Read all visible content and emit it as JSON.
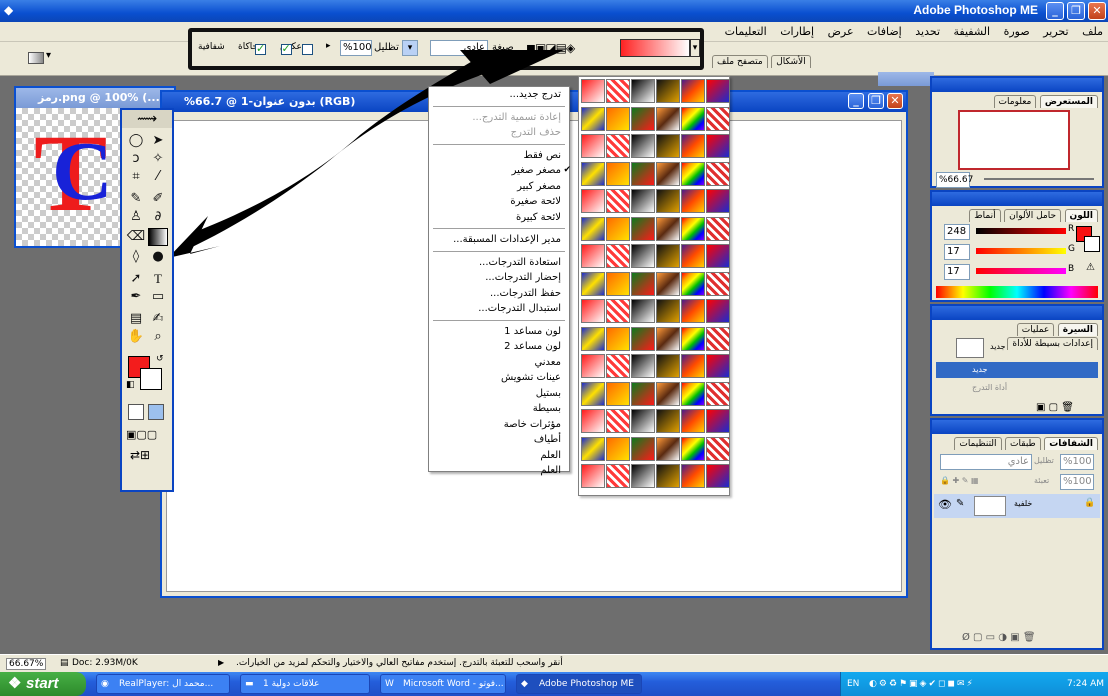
{
  "app": {
    "title": "Adobe Photoshop ME",
    "menu": [
      "ملف",
      "تحرير",
      "صورة",
      "الشفيفة",
      "تحديد",
      "إضافات",
      "عرض",
      "إطارات",
      "التعليمات"
    ]
  },
  "options": {
    "mode_label": "صيغة",
    "mode_value": "عادي",
    "opacity_label": "تظليل",
    "opacity_value": "%100",
    "reverse_label": "عكس",
    "dither_label": "محاكاة",
    "transparency_label": "شفافية",
    "tab_brushes": "الأشكال",
    "tab_file_browser": "متصفح ملف"
  },
  "documents": {
    "doc1_title": "رمز.png @ 100% (...",
    "doc2_title": "%بدون عنوان-1 @ 66.7 (RGB)"
  },
  "gradient_menu": {
    "items": [
      {
        "label": "تدرج جديد...",
        "state": "normal"
      },
      {
        "sep": true
      },
      {
        "label": "إعادة تسمية التدرج...",
        "state": "disabled"
      },
      {
        "label": "حذف التدرج",
        "state": "disabled"
      },
      {
        "sep": true
      },
      {
        "label": "نص فقط",
        "state": "normal"
      },
      {
        "label": "مصغر صغير",
        "state": "checked"
      },
      {
        "label": "مصغر كبير",
        "state": "normal"
      },
      {
        "label": "لائحة صغيرة",
        "state": "normal"
      },
      {
        "label": "لائحة كبيرة",
        "state": "normal"
      },
      {
        "sep": true
      },
      {
        "label": "مدير الإعدادات المسبقة...",
        "state": "normal"
      },
      {
        "sep": true
      },
      {
        "label": "استعادة التدرجات...",
        "state": "normal"
      },
      {
        "label": "إحضار التدرجات...",
        "state": "normal"
      },
      {
        "label": "حفظ التدرجات...",
        "state": "normal"
      },
      {
        "label": "استبدال التدرجات...",
        "state": "normal"
      },
      {
        "sep": true
      },
      {
        "label": "لون مساعد 1",
        "state": "normal"
      },
      {
        "label": "لون مساعد 2",
        "state": "normal"
      },
      {
        "label": "معدني",
        "state": "normal"
      },
      {
        "label": "عينات تشويش",
        "state": "normal"
      },
      {
        "label": "بستيل",
        "state": "normal"
      },
      {
        "label": "بسيطة",
        "state": "normal"
      },
      {
        "label": "مؤثرات خاصة",
        "state": "normal"
      },
      {
        "label": "أطياف",
        "state": "normal"
      },
      {
        "label": "العلم",
        "state": "normal"
      },
      {
        "label": "العلم",
        "state": "normal"
      }
    ]
  },
  "navigator": {
    "tab_info": "معلومات",
    "tab_navigator": "المستعرض",
    "zoom": "%66.67"
  },
  "color_palette": {
    "tab_styles": "أنماط",
    "tab_swatches": "حامل الألوان",
    "tab_color": "اللون",
    "r_label": "R",
    "g_label": "G",
    "b_label": "B",
    "r_value": "248",
    "g_value": "17",
    "b_value": "17",
    "accent": "#f81111"
  },
  "history": {
    "tab_actions": "إعدادات بسيطة للأداة",
    "tab_history": "عمليات",
    "tab_main": "السيرة",
    "snapshot_label": "جديد",
    "item1": "جديد",
    "item2": "أداة التدرج"
  },
  "layers": {
    "tab_channels": "التنظيمات",
    "tab_paths": "طبقات",
    "tab_layers": "الشفافات",
    "blend": "عادي",
    "opacity_label": "تظليل",
    "opacity_value": "%100",
    "fill_label": "تعبئة",
    "fill_value": "%100",
    "layer_name": "خلفية"
  },
  "status": {
    "zoom": "66.67%",
    "doc": "Doc: 2.93M/0K",
    "hint": "أنقر واسحب للتعبئة بالتدرج. إستخدم مفاتيح العالي والاختيار والتحكم لمزيد من الخيارات."
  },
  "taskbar": {
    "start": "start",
    "tasks": [
      "RealPlayer: محمد ال...",
      "علاقات دولية 1",
      "Microsoft Word - فوتو...",
      "Adobe Photoshop ME"
    ],
    "lang": "EN",
    "clock": "7:24 AM"
  }
}
